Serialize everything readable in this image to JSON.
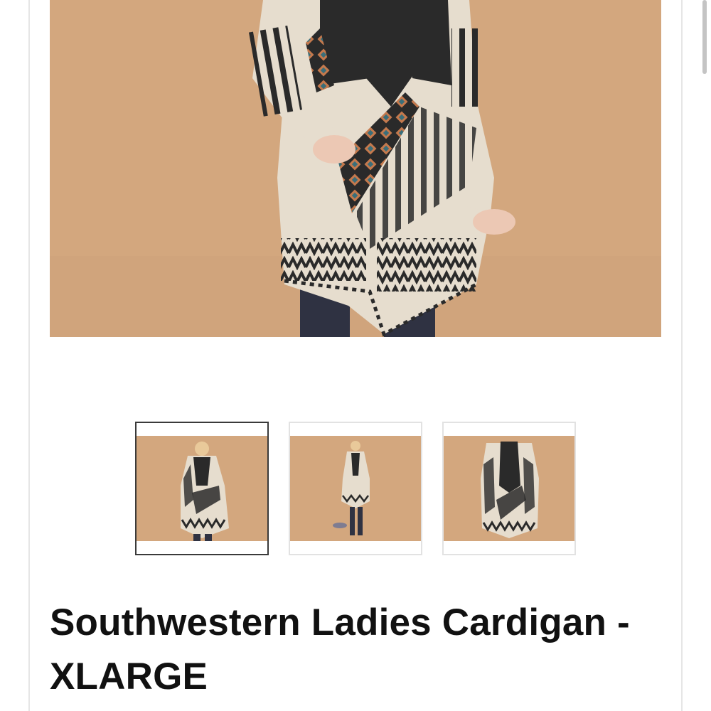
{
  "product": {
    "title": "Southwestern Ladies Cardigan - XLARGE",
    "main_image": {
      "alt": "main-product-image",
      "background_color": "#d3a77e"
    },
    "thumbnails": [
      {
        "alt": "thumbnail-front-view",
        "selected": true
      },
      {
        "alt": "thumbnail-full-length-view",
        "selected": false
      },
      {
        "alt": "thumbnail-flat-view",
        "selected": false
      }
    ]
  },
  "colors": {
    "backdrop": "#d3a77e",
    "cardigan_cream": "#e6ddce",
    "pattern_dark": "#2a2a2a",
    "pants": "#2f3242",
    "skin": "#ecc8b4",
    "title_text": "#111111",
    "selected_border": "#3a3a3a",
    "thumb_border": "#e2e2e2"
  }
}
